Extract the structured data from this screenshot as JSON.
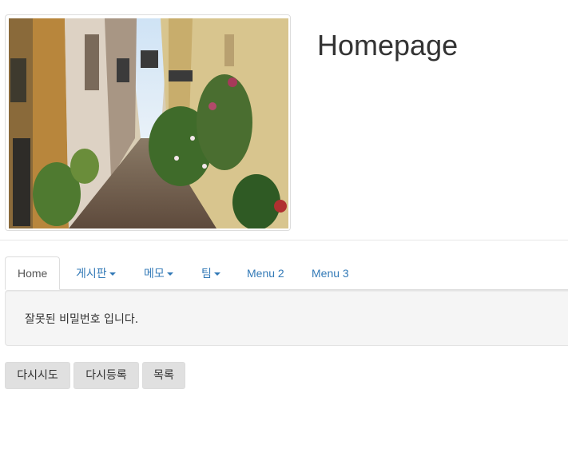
{
  "header": {
    "title": "Homepage",
    "image_alt": "Narrow alley between old buildings with flowers"
  },
  "nav": {
    "tabs": [
      {
        "label": "Home",
        "active": true,
        "dropdown": false
      },
      {
        "label": "게시판",
        "active": false,
        "dropdown": true
      },
      {
        "label": "메모",
        "active": false,
        "dropdown": true
      },
      {
        "label": "팀",
        "active": false,
        "dropdown": true
      },
      {
        "label": "Menu 2",
        "active": false,
        "dropdown": false
      },
      {
        "label": "Menu 3",
        "active": false,
        "dropdown": false
      }
    ]
  },
  "alert": {
    "message": "잘못된 비밀번호 입니다."
  },
  "actions": {
    "retry_label": "다시시도",
    "reregister_label": "다시등록",
    "list_label": "목록"
  },
  "colors": {
    "link": "#337ab7",
    "active_tab_text": "#555555",
    "alert_bg": "#f5f5f5",
    "button_bg": "#e0e0e0"
  }
}
